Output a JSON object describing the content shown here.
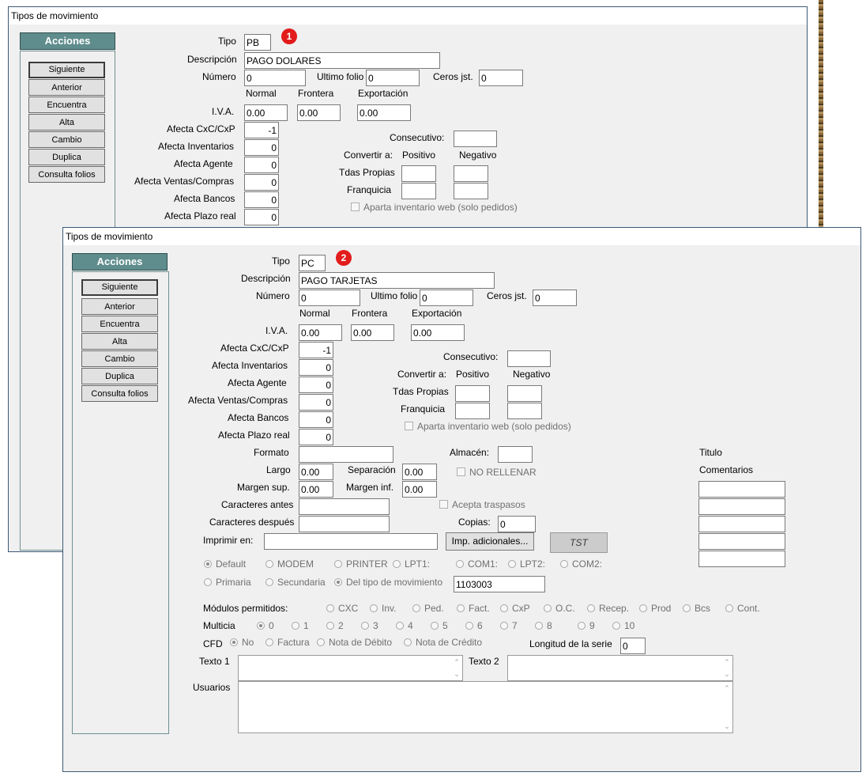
{
  "window_back": {
    "title": "Tipos de movimiento",
    "badge": "1",
    "actions_title": "Acciones",
    "actions": [
      "Siguiente",
      "Anterior",
      "Encuentra",
      "Alta",
      "Cambio",
      "Duplica",
      "Consulta folios"
    ],
    "tipo_label": "Tipo",
    "tipo_value": "PB",
    "descripcion_label": "Descripción",
    "descripcion_value": "PAGO DOLARES",
    "numero_label": "Número",
    "numero_value": "0",
    "ultimo_folio_label": "Ultimo folio",
    "ultimo_folio_value": "0",
    "ceros_label": "Ceros jst.",
    "ceros_value": "0",
    "col_normal": "Normal",
    "col_frontera": "Frontera",
    "col_exportacion": "Exportación",
    "iva_label": "I.V.A.",
    "iva_normal": "0.00",
    "iva_frontera": "0.00",
    "iva_exportacion": "0.00",
    "afecta": [
      {
        "label": "Afecta  CxC/CxP",
        "value": "-1"
      },
      {
        "label": "Afecta  Inventarios",
        "value": "0"
      },
      {
        "label": "Afecta  Agente",
        "value": "0"
      },
      {
        "label": "Afecta  Ventas/Compras",
        "value": "0"
      },
      {
        "label": "Afecta  Bancos",
        "value": "0"
      },
      {
        "label": "Afecta  Plazo real",
        "value": "0"
      }
    ],
    "consecutivo_label": "Consecutivo:",
    "convertir_label": "Convertir a:",
    "positivo_label": "Positivo",
    "negativo_label": "Negativo",
    "tdas_propias_label": "Tdas Propias",
    "franquicia_label": "Franquicia",
    "aparta_label": "Aparta inventario web (solo pedidos)"
  },
  "window_front": {
    "title": "Tipos de movimiento",
    "badge": "2",
    "actions_title": "Acciones",
    "actions": [
      "Siguiente",
      "Anterior",
      "Encuentra",
      "Alta",
      "Cambio",
      "Duplica",
      "Consulta folios"
    ],
    "tipo_label": "Tipo",
    "tipo_value": "PC",
    "descripcion_label": "Descripción",
    "descripcion_value": "PAGO TARJETAS",
    "numero_label": "Número",
    "numero_value": "0",
    "ultimo_folio_label": "Ultimo folio",
    "ultimo_folio_value": "0",
    "ceros_label": "Ceros jst.",
    "ceros_value": "0",
    "col_normal": "Normal",
    "col_frontera": "Frontera",
    "col_exportacion": "Exportación",
    "iva_label": "I.V.A.",
    "iva_normal": "0.00",
    "iva_frontera": "0.00",
    "iva_exportacion": "0.00",
    "afecta": [
      {
        "label": "Afecta  CxC/CxP",
        "value": "-1"
      },
      {
        "label": "Afecta  Inventarios",
        "value": "0"
      },
      {
        "label": "Afecta  Agente",
        "value": "0"
      },
      {
        "label": "Afecta  Ventas/Compras",
        "value": "0"
      },
      {
        "label": "Afecta  Bancos",
        "value": "0"
      },
      {
        "label": "Afecta  Plazo real",
        "value": "0"
      }
    ],
    "consecutivo_label": "Consecutivo:",
    "convertir_label": "Convertir a:",
    "positivo_label": "Positivo",
    "negativo_label": "Negativo",
    "tdas_propias_label": "Tdas Propias",
    "franquicia_label": "Franquicia",
    "aparta_label": "Aparta inventario web (solo pedidos)",
    "formato_label": "Formato",
    "almacen_label": "Almacén:",
    "titulo_label": "Titulo",
    "comentarios_label": "Comentarios",
    "largo_label": "Largo",
    "largo_value": "0.00",
    "separacion_label": "Separación",
    "separacion_value": "0.00",
    "no_rellenar_label": "NO RELLENAR",
    "margen_sup_label": "Margen sup.",
    "margen_sup_value": "0.00",
    "margen_inf_label": "Margen inf.",
    "margen_inf_value": "0.00",
    "caracteres_antes_label": "Caracteres antes",
    "acepta_traspasos_label": "Acepta traspasos",
    "caracteres_despues_label": "Caracteres después",
    "copias_label": "Copias:",
    "copias_value": "0",
    "imprimir_en_label": "Imprimir en:",
    "imp_adicionales_label": "Imp. adicionales...",
    "tst_label": "TST",
    "printers": [
      {
        "label": "Default",
        "selected": true
      },
      {
        "label": "MODEM",
        "selected": false
      },
      {
        "label": "PRINTER",
        "selected": false
      },
      {
        "label": "LPT1:",
        "selected": false
      },
      {
        "label": "COM1:",
        "selected": false
      },
      {
        "label": "LPT2:",
        "selected": false
      },
      {
        "label": "COM2:",
        "selected": false
      }
    ],
    "source": [
      {
        "label": "Primaria",
        "selected": false
      },
      {
        "label": "Secundaria",
        "selected": false
      },
      {
        "label": "Del tipo de movimiento",
        "selected": true
      }
    ],
    "tipo_mov_value": "1103003",
    "modulos_label": "Módulos permitidos:",
    "modulos": [
      "CXC",
      "Inv.",
      "Ped.",
      "Fact.",
      "CxP",
      "O.C.",
      "Recep.",
      "Prod",
      "Bcs",
      "Cont."
    ],
    "multicia_label": "Multicia",
    "multicia": [
      "0",
      "1",
      "2",
      "3",
      "4",
      "5",
      "6",
      "7",
      "8",
      "9",
      "10"
    ],
    "cfd_label": "CFD",
    "cfd": [
      {
        "label": "No",
        "selected": true
      },
      {
        "label": "Factura",
        "selected": false
      },
      {
        "label": "Nota de Débito",
        "selected": false
      },
      {
        "label": "Nota de Crédito",
        "selected": false
      }
    ],
    "longitud_serie_label": "Longitud de la serie",
    "longitud_serie_value": "0",
    "texto1_label": "Texto 1",
    "texto2_label": "Texto 2",
    "usuarios_label": "Usuarios"
  }
}
